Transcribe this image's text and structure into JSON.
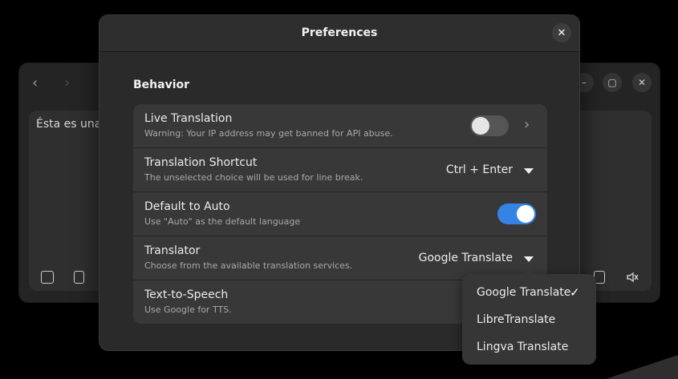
{
  "background_window": {
    "back_icon": "chevron-left-icon",
    "forward_icon": "chevron-right-icon",
    "window_buttons": {
      "minimize": "–",
      "maximize": "▢",
      "close": "✕"
    },
    "source_text": "Ésta es una",
    "left_icons": [
      "clear-icon",
      "paste-icon"
    ],
    "right_icons": [
      "copy-icon",
      "mute-icon"
    ]
  },
  "dialog": {
    "title": "Preferences",
    "close_glyph": "✕",
    "section_title": "Behavior",
    "rows": [
      {
        "title": "Live Translation",
        "subtitle": "Warning: Your IP address may get banned for API abuse.",
        "control": "switch",
        "switch_on": false,
        "chevron": "›"
      },
      {
        "title": "Translation Shortcut",
        "subtitle": "The unselected choice will be used for line break.",
        "control": "dropdown",
        "value": "Ctrl + Enter"
      },
      {
        "title": "Default to Auto",
        "subtitle": "Use \"Auto\" as the default language",
        "control": "switch",
        "switch_on": true
      },
      {
        "title": "Translator",
        "subtitle": "Choose from the available translation services.",
        "control": "dropdown",
        "value": "Google Translate"
      },
      {
        "title": "Text-to-Speech",
        "subtitle": "Use Google for TTS."
      }
    ]
  },
  "popover": {
    "options": [
      {
        "label": "Google Translate",
        "selected": true
      },
      {
        "label": "LibreTranslate",
        "selected": false
      },
      {
        "label": "Lingva Translate",
        "selected": false
      }
    ],
    "check_glyph": "✓"
  },
  "colors": {
    "accent": "#3584e4",
    "dialog_bg": "#2a2a2a",
    "row_bg": "#383838"
  }
}
